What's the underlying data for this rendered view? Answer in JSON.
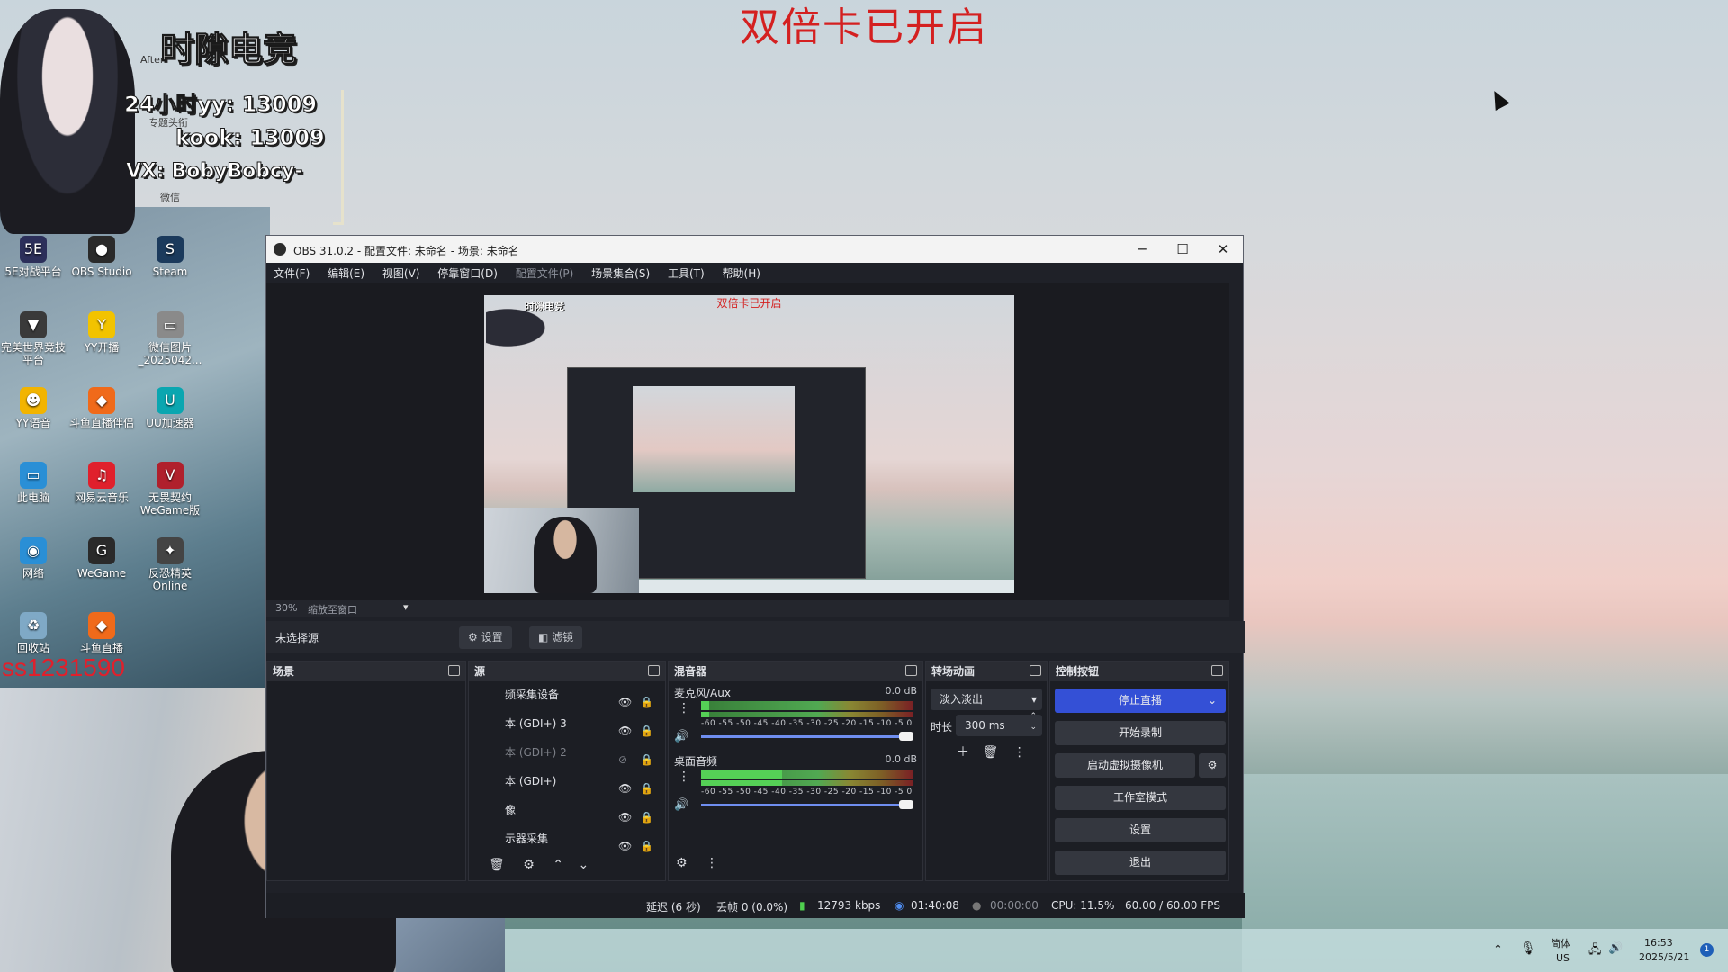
{
  "banner": "双倍卡已开启",
  "overlay": {
    "title": "时隙电竞",
    "yy_line": "24小时yy:  13009",
    "kook_line": "kook:  13009",
    "vx_line": "VX: BobyBobcy-",
    "sub1": "专题头衔",
    "sub2": "微信",
    "after": "After",
    "id_tag": "ss1231590"
  },
  "desktop_icons": [
    {
      "label": "5E对战平台",
      "icon": "5E",
      "color": "#2c2f5a"
    },
    {
      "label": "OBS Studio",
      "icon": "●",
      "color": "#2a2a2a"
    },
    {
      "label": "Steam",
      "icon": "S",
      "color": "#1b3a5c"
    },
    {
      "label": "完美世界竞技平台",
      "icon": "▼",
      "color": "#3a3a3a"
    },
    {
      "label": "YY开播",
      "icon": "Y",
      "color": "#f2c300"
    },
    {
      "label": "微信图片_2025042...",
      "icon": "▭",
      "color": "#8a8a8a"
    },
    {
      "label": "YY语音",
      "icon": "☻",
      "color": "#f2b400"
    },
    {
      "label": "斗鱼直播伴侣",
      "icon": "◆",
      "color": "#f06a1a"
    },
    {
      "label": "UU加速器",
      "icon": "U",
      "color": "#0aa6b0"
    },
    {
      "label": "此电脑",
      "icon": "▭",
      "color": "#2a8fd6"
    },
    {
      "label": "网易云音乐",
      "icon": "♫",
      "color": "#e0202c"
    },
    {
      "label": "无畏契约WeGame版",
      "icon": "V",
      "color": "#b0202c"
    },
    {
      "label": "网络",
      "icon": "◉",
      "color": "#2a8fd6"
    },
    {
      "label": "WeGame",
      "icon": "G",
      "color": "#2a2a2a"
    },
    {
      "label": "反恐精英Online",
      "icon": "✦",
      "color": "#444444"
    },
    {
      "label": "回收站",
      "icon": "♻",
      "color": "#7fa9c6"
    },
    {
      "label": "斗鱼直播",
      "icon": "◆",
      "color": "#f06a1a"
    }
  ],
  "obs": {
    "window_title": "OBS 31.0.2 - 配置文件: 未命名 - 场景: 未命名",
    "win_min": "─",
    "win_max": "☐",
    "win_close": "✕",
    "menu": [
      "文件(F)",
      "编辑(E)",
      "视图(V)",
      "停靠窗口(D)",
      "配置文件(P)",
      "场景集合(S)",
      "工具(T)",
      "帮助(H)"
    ],
    "preview_banner": "双倍卡已开启",
    "preview_overlay_title": "时隙电竞",
    "zoom": "30%",
    "zoom_mode": "缩放至窗口",
    "no_source": "未选择源",
    "settings_btn": "设置",
    "filters_btn": "滤镜",
    "docks": {
      "scenes": "场景",
      "sources": "源",
      "mixer": "混音器",
      "transitions": "转场动画",
      "controls": "控制按钮"
    },
    "sources": [
      {
        "name": "频采集设备",
        "visible": true
      },
      {
        "name": "本 (GDI+) 3",
        "visible": true
      },
      {
        "name": "本 (GDI+) 2",
        "visible": false
      },
      {
        "name": "本 (GDI+)",
        "visible": true
      },
      {
        "name": "像",
        "visible": true
      },
      {
        "name": "示器采集",
        "visible": true
      }
    ],
    "mixer": [
      {
        "name": "麦克风/Aux",
        "db": "0.0 dB",
        "level": 0.04
      },
      {
        "name": "桌面音频",
        "db": "0.0 dB",
        "level": 0.38
      }
    ],
    "meter_scale": "-60  -55  -50  -45  -40  -35  -30  -25  -20  -15  -10  -5  0",
    "transition": {
      "type": "淡入淡出",
      "duration_label": "时长",
      "duration": "300 ms"
    },
    "controls": {
      "stop_stream": "停止直播",
      "start_record": "开始录制",
      "virtual_cam": "启动虚拟摄像机",
      "studio_mode": "工作室模式",
      "settings": "设置",
      "exit": "退出"
    },
    "status": {
      "delay": "延迟 (6 秒)",
      "dropped": "丢帧 0 (0.0%)",
      "bitrate": "12793 kbps",
      "stream_time": "01:40:08",
      "record_time": "00:00:00",
      "cpu": "CPU: 11.5%",
      "fps": "60.00 / 60.00 FPS"
    },
    "colors": {
      "accent": "#3450d6",
      "bg": "#1f2128"
    }
  },
  "taskbar": {
    "ime_lang": "简体",
    "ime_region": "US",
    "time": "16:53",
    "date": "2025/5/21",
    "notif": "1"
  }
}
